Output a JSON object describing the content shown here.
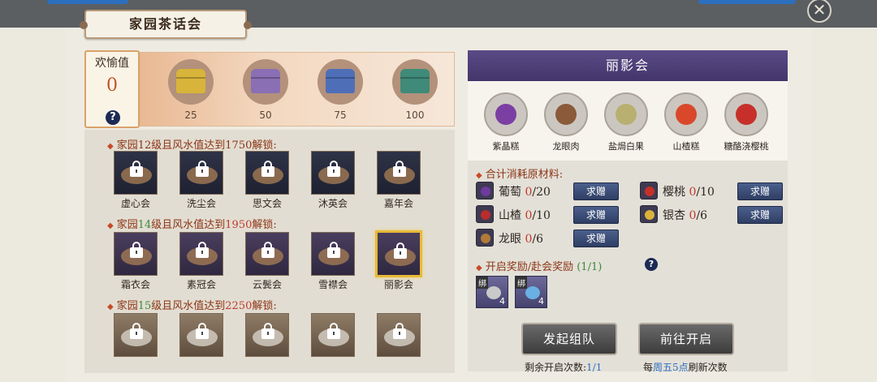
{
  "title": "家园茶话会",
  "close_icon": "close-x-icon",
  "joy": {
    "label": "欢愉值",
    "value": "0",
    "help": "?"
  },
  "chests": [
    {
      "threshold": "25",
      "color": "#d8b43a"
    },
    {
      "threshold": "50",
      "color": "#8a6fb5"
    },
    {
      "threshold": "75",
      "color": "#4e6fb8"
    },
    {
      "threshold": "100",
      "color": "#3f8a78"
    }
  ],
  "sections": [
    {
      "prefix": "家园",
      "level": "12",
      "mid": "级且风水值达到",
      "fengshui": "1750",
      "suffix": "解锁:",
      "items": [
        "虚心会",
        "洗尘会",
        "思文会",
        "沐英会",
        "嘉年会"
      ]
    },
    {
      "prefix": "家园",
      "level": "14",
      "mid": "级且风水值达到",
      "fengshui": "1950",
      "suffix": "解锁:",
      "items": [
        "霜衣会",
        "素冠会",
        "云鬓会",
        "雪襟会",
        "丽影会"
      ]
    },
    {
      "prefix": "家园",
      "level": "15",
      "mid": "级且风水值达到",
      "fengshui": "2250",
      "suffix": "解锁:",
      "items": [
        "",
        "",
        "",
        "",
        ""
      ]
    }
  ],
  "panel": {
    "header": "丽影会",
    "dishes": [
      {
        "name": "紫晶糕",
        "color": "#7b3fa3"
      },
      {
        "name": "龙眼肉",
        "color": "#8a5a3a"
      },
      {
        "name": "盐焗白果",
        "color": "#b8b070"
      },
      {
        "name": "山楂糕",
        "color": "#d9482b"
      },
      {
        "name": "糖酪浇樱桃",
        "color": "#c7302a"
      }
    ],
    "materials_title": "合计消耗原材料:",
    "materials": [
      {
        "name": "葡萄",
        "current": "0",
        "total": "/20",
        "ask": "求赠",
        "color": "#6e3aa0"
      },
      {
        "name": "樱桃",
        "current": "0",
        "total": "/10",
        "ask": "求赠",
        "color": "#c7302a"
      },
      {
        "name": "山楂",
        "current": "0",
        "total": "/10",
        "ask": "求赠",
        "color": "#b82d2d"
      },
      {
        "name": "银杏",
        "current": "0",
        "total": "/6",
        "ask": "求赠",
        "color": "#d9b33a"
      },
      {
        "name": "龙眼",
        "current": "0",
        "total": "/6",
        "ask": "求赠",
        "color": "#b07a3a"
      }
    ],
    "reward_title": "开启奖励/赴会奖励",
    "reward_count": "(1/1)",
    "reward_help": "?",
    "reward_items": [
      {
        "tag": "绑",
        "qty": "4",
        "color": "#c9c9c9"
      },
      {
        "tag": "绑",
        "qty": "4",
        "color": "#6ab0e3"
      }
    ],
    "btn_team": "发起组队",
    "btn_open": "前往开启",
    "remaining_label": "剩余开启次数:",
    "remaining_value": "1/1",
    "refresh_pre": "每",
    "refresh_time": "周五5点",
    "refresh_post": "刷新次数"
  }
}
